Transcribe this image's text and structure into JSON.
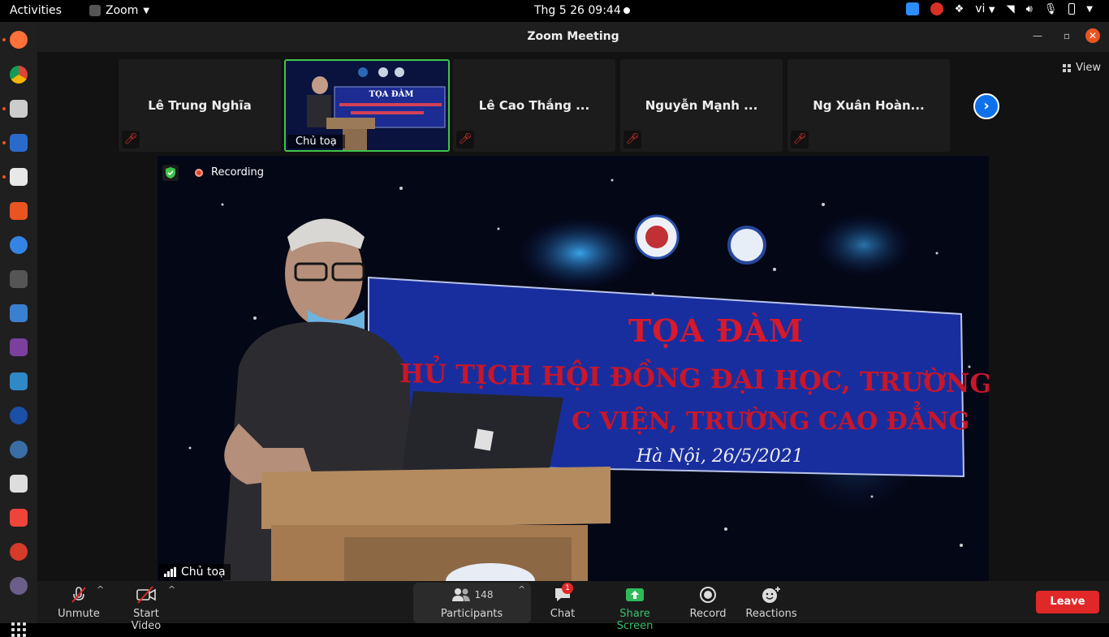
{
  "system": {
    "activities": "Activities",
    "app_name": "Zoom",
    "clock": "Thg 5 26  09:44",
    "language": "vi"
  },
  "window": {
    "title": "Zoom Meeting"
  },
  "thumbnails": [
    {
      "name": "Lê Trung Nghĩa",
      "muted": true
    },
    {
      "name": "Chủ toạ",
      "active": true
    },
    {
      "name": "Lê Cao Thắng ...",
      "muted": true
    },
    {
      "name": "Nguyễn Mạnh ...",
      "muted": true
    },
    {
      "name": "Ng Xuân Hoàn...",
      "muted": true
    }
  ],
  "view_label": "View",
  "main_video": {
    "recording_label": "Recording",
    "speaker_label": "Chủ toạ",
    "banner": {
      "title": "TỌA ĐÀM",
      "line1": "HỦ TỊCH HỘI ĐỒNG ĐẠI HỌC, TRƯỜNG ĐẠI HỌC,",
      "line2": "C VIỆN, TRƯỜNG CAO ĐẲNG",
      "date": "Hà Nội, 26/5/2021"
    }
  },
  "toolbar": {
    "unmute": "Unmute",
    "start_video": "Start Video",
    "participants": "Participants",
    "participants_count": "148",
    "chat": "Chat",
    "chat_badge": "1",
    "share_screen": "Share Screen",
    "record": "Record",
    "reactions": "Reactions",
    "leave": "Leave"
  },
  "colors": {
    "accent_green": "#39c16c",
    "leave_red": "#e02828",
    "zoom_blue": "#0e71eb"
  }
}
